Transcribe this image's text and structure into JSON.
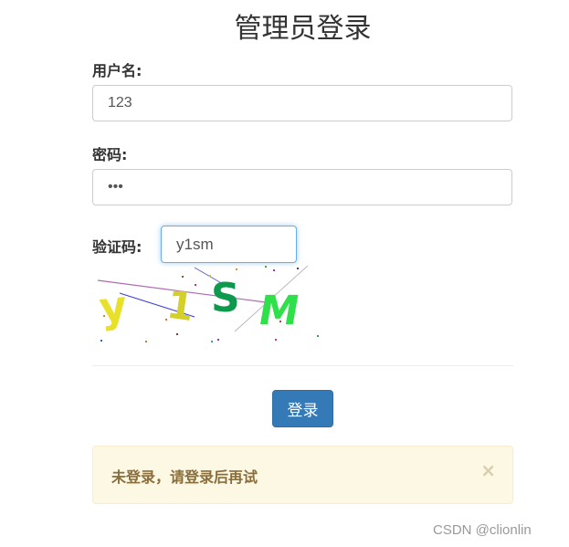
{
  "page": {
    "title": "管理员登录"
  },
  "form": {
    "username_label": "用户名:",
    "username_value": "123",
    "password_label": "密码:",
    "password_value": "123",
    "captcha_label": "验证码:",
    "captcha_value": "y1sm",
    "captcha_image_text": [
      "y",
      "1",
      "S",
      "M"
    ],
    "captcha_colors": [
      "#e8e02b",
      "#d4d02a",
      "#0e9a4c",
      "#2fe04a"
    ]
  },
  "buttons": {
    "login_label": "登录"
  },
  "alert": {
    "message": "未登录，请登录后再试",
    "close_label": "×"
  },
  "watermark": "CSDN @clionlin",
  "colors": {
    "primary": "#337ab7",
    "warning_bg": "#fcf8e3",
    "warning_text": "#8a6d3b",
    "focus_border": "#66afe9"
  }
}
